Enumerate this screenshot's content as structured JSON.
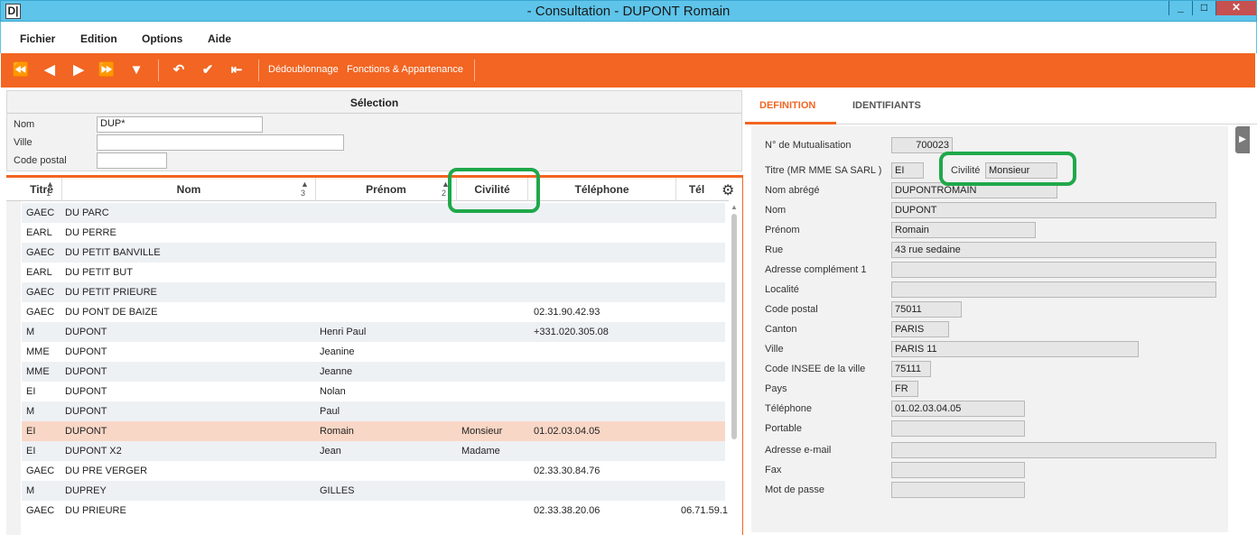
{
  "window": {
    "title": "- Consultation - DUPONT Romain",
    "app_icon_text": "D|",
    "min_label": "_",
    "max_label": "□",
    "close_label": "✕"
  },
  "menu": [
    "Fichier",
    "Edition",
    "Options",
    "Aide"
  ],
  "toolbar": {
    "first_icon": "⏪",
    "prev_icon": "◀",
    "next_icon": "▶",
    "last_icon": "⏩",
    "filter_icon": "▼",
    "undo_icon": "↶",
    "validate_icon": "✔",
    "back_icon": "⇤",
    "dedoublonnage": "Dédoublonnage",
    "fonctions": "Fonctions & Appartenance"
  },
  "selection": {
    "title": "Sélection",
    "nom_label": "Nom",
    "nom_value": "DUP*",
    "ville_label": "Ville",
    "ville_value": "",
    "cp_label": "Code postal",
    "cp_value": ""
  },
  "grid": {
    "columns": [
      "Titre",
      "Nom",
      "Prénom",
      "Civilité",
      "Téléphone",
      "Tél"
    ],
    "sort": {
      "titre": "1",
      "nom": "3",
      "prenom": "2"
    },
    "rows": [
      {
        "titre": "GAEC",
        "nom": "DU PARC",
        "prenom": "",
        "civilite": "",
        "tel": "",
        "tel2": ""
      },
      {
        "titre": "EARL",
        "nom": "DU PERRE",
        "prenom": "",
        "civilite": "",
        "tel": "",
        "tel2": ""
      },
      {
        "titre": "GAEC",
        "nom": "DU PETIT BANVILLE",
        "prenom": "",
        "civilite": "",
        "tel": "",
        "tel2": ""
      },
      {
        "titre": "EARL",
        "nom": "DU PETIT BUT",
        "prenom": "",
        "civilite": "",
        "tel": "",
        "tel2": ""
      },
      {
        "titre": "GAEC",
        "nom": "DU PETIT PRIEURE",
        "prenom": "",
        "civilite": "",
        "tel": "",
        "tel2": ""
      },
      {
        "titre": "GAEC",
        "nom": "DU PONT DE BAIZE",
        "prenom": "",
        "civilite": "",
        "tel": "02.31.90.42.93",
        "tel2": ""
      },
      {
        "titre": "M",
        "nom": "DUPONT",
        "prenom": "Henri Paul",
        "civilite": "",
        "tel": "+331.020.305.08",
        "tel2": ""
      },
      {
        "titre": "MME",
        "nom": "DUPONT",
        "prenom": "Jeanine",
        "civilite": "",
        "tel": "",
        "tel2": ""
      },
      {
        "titre": "MME",
        "nom": "DUPONT",
        "prenom": "Jeanne",
        "civilite": "",
        "tel": "",
        "tel2": ""
      },
      {
        "titre": "EI",
        "nom": "DUPONT",
        "prenom": "Nolan",
        "civilite": "",
        "tel": "",
        "tel2": ""
      },
      {
        "titre": "M",
        "nom": "DUPONT",
        "prenom": "Paul",
        "civilite": "",
        "tel": "",
        "tel2": ""
      },
      {
        "titre": "EI",
        "nom": "DUPONT",
        "prenom": "Romain",
        "civilite": "Monsieur",
        "tel": "01.02.03.04.05",
        "tel2": ""
      },
      {
        "titre": "EI",
        "nom": "DUPONT X2",
        "prenom": "Jean",
        "civilite": "Madame",
        "tel": "",
        "tel2": ""
      },
      {
        "titre": "GAEC",
        "nom": "DU PRE VERGER",
        "prenom": "",
        "civilite": "",
        "tel": "02.33.30.84.76",
        "tel2": ""
      },
      {
        "titre": "M",
        "nom": "DUPREY",
        "prenom": "GILLES",
        "civilite": "",
        "tel": "",
        "tel2": ""
      },
      {
        "titre": "GAEC",
        "nom": "DU PRIEURE",
        "prenom": "",
        "civilite": "",
        "tel": "02.33.38.20.06",
        "tel2": "06.71.59.1"
      }
    ]
  },
  "tabs": [
    "DEFINITION",
    "IDENTIFIANTS"
  ],
  "form": {
    "mutualisation_label": "N° de Mutualisation",
    "mutualisation_value": "700023",
    "titre_label": "Titre (MR MME SA SARL )",
    "titre_value": "EI",
    "civilite_label": "Civilité",
    "civilite_value": "Monsieur",
    "nom_abrege_label": "Nom abrégé",
    "nom_abrege_value": "DUPONTROMAIN",
    "nom_label": "Nom",
    "nom_value": "DUPONT",
    "prenom_label": "Prénom",
    "prenom_value": "Romain",
    "rue_label": "Rue",
    "rue_value": "43 rue sedaine",
    "adresse_comp_label": "Adresse complément 1",
    "adresse_comp_value": "",
    "localite_label": "Localité",
    "localite_value": "",
    "code_postal_label": "Code postal",
    "code_postal_value": "75011",
    "canton_label": "Canton",
    "canton_value": "PARIS",
    "ville_label": "Ville",
    "ville_value": "PARIS 11",
    "insee_label": "Code INSEE de la ville",
    "insee_value": "75111",
    "pays_label": "Pays",
    "pays_value": "FR",
    "telephone_label": "Téléphone",
    "telephone_value": "01.02.03.04.05",
    "portable_label": "Portable",
    "portable_value": "",
    "email_label": "Adresse e-mail",
    "email_value": "",
    "fax_label": "Fax",
    "fax_value": "",
    "mdp_label": "Mot de passe",
    "mdp_value": ""
  },
  "colors": {
    "accent": "#f26522",
    "titlebar": "#5ec4ea",
    "highlight": "#1fa84a",
    "selected_row": "#f9d7c6"
  }
}
